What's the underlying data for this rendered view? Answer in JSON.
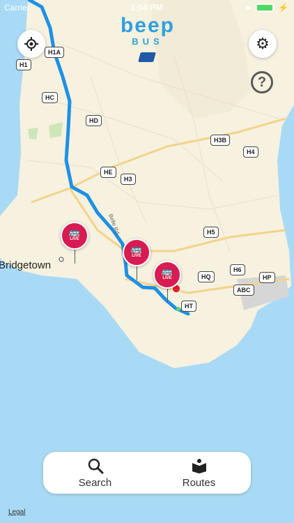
{
  "status_bar": {
    "carrier": "Carrier",
    "time": "1:04 PM",
    "battery_color": "#4cd964"
  },
  "logo": {
    "main": "beep",
    "sub": "BUS"
  },
  "controls": {
    "locate_icon": "crosshair-icon",
    "settings_icon": "gear-icon",
    "help_label": "?"
  },
  "map": {
    "city": "Bridgetown",
    "road_labels": [
      "H1",
      "H1A",
      "HC",
      "HD",
      "H3B",
      "H4",
      "HE",
      "H3",
      "H5",
      "H6",
      "HP",
      "HQ",
      "ABC",
      "HT"
    ],
    "route_color": "#1e90e6",
    "live_label": "LIVE",
    "bus_pin_color": "#d81b52"
  },
  "tab_bar": {
    "search_label": "Search",
    "routes_label": "Routes"
  },
  "legal": "Legal"
}
